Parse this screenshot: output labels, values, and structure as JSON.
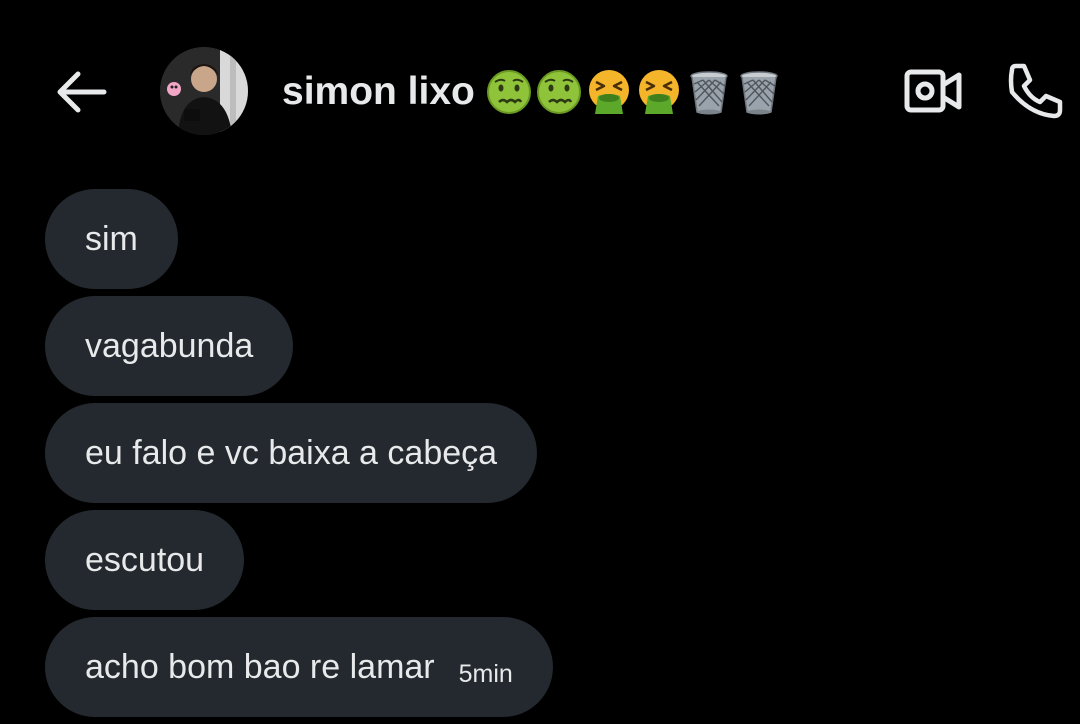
{
  "header": {
    "back_icon": "arrow-left-icon",
    "contact_name": "simon lixo",
    "title_emojis": [
      {
        "name": "nauseated-face-emoji",
        "color": "#8fc33a"
      },
      {
        "name": "nauseated-face-emoji",
        "color": "#8fc33a"
      },
      {
        "name": "face-vomiting-emoji",
        "color": "#f5b52b"
      },
      {
        "name": "face-vomiting-emoji",
        "color": "#f5b52b"
      },
      {
        "name": "wastebasket-emoji",
        "color": "#9aa3ab"
      },
      {
        "name": "wastebasket-emoji",
        "color": "#9aa3ab"
      }
    ],
    "video_icon": "video-camera-icon",
    "call_icon": "phone-icon"
  },
  "messages": [
    {
      "text": "sim"
    },
    {
      "text": "vagabunda"
    },
    {
      "text": "eu falo e vc baixa a cabeça"
    },
    {
      "text": "escutou"
    },
    {
      "text": "acho bom bao re lamar",
      "time": "5min"
    }
  ],
  "colors": {
    "background": "#000000",
    "bubble": "#24292f",
    "text": "#e7e9ea"
  }
}
